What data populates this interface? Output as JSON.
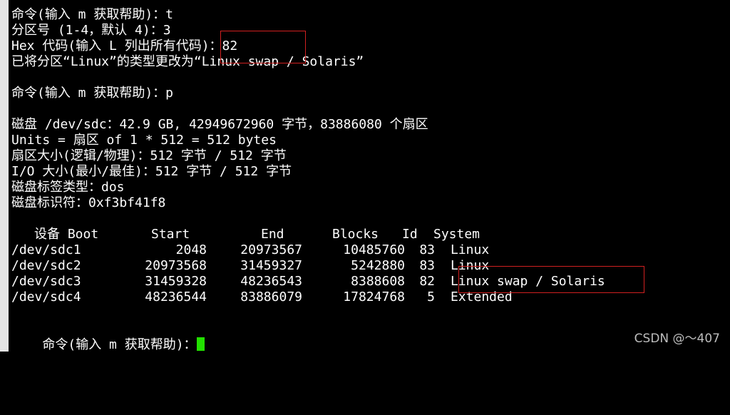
{
  "terminal": {
    "lines": [
      "命令(输入 m 获取帮助)：t",
      "分区号 (1-4，默认 4)：3",
      "Hex 代码(输入 L 列出所有代码)：82",
      "已将分区“Linux”的类型更改为“Linux swap / Solaris”",
      "",
      "命令(输入 m 获取帮助)：p",
      "",
      "磁盘 /dev/sdc：42.9 GB, 42949672960 字节，83886080 个扇区",
      "Units = 扇区 of 1 * 512 = 512 bytes",
      "扇区大小(逻辑/物理)：512 字节 / 512 字节",
      "I/O 大小(最小/最佳)：512 字节 / 512 字节",
      "磁盘标签类型：dos",
      "磁盘标识符：0xf3bf41f8"
    ],
    "table": {
      "headers": {
        "device": "设备 Boot",
        "start": "Start",
        "end": "End",
        "blocks": "Blocks",
        "id": "Id",
        "system": "System"
      },
      "rows": [
        {
          "device": "/dev/sdc1",
          "start": "2048",
          "end": "20973567",
          "blocks": "10485760",
          "id": "83",
          "system": "Linux"
        },
        {
          "device": "/dev/sdc2",
          "start": "20973568",
          "end": "31459327",
          "blocks": "5242880",
          "id": "83",
          "system": "Linux"
        },
        {
          "device": "/dev/sdc3",
          "start": "31459328",
          "end": "48236543",
          "blocks": "8388608",
          "id": "82",
          "system": "Linux swap / Solaris"
        },
        {
          "device": "/dev/sdc4",
          "start": "48236544",
          "end": "83886079",
          "blocks": "17824768",
          "id": "5",
          "system": "Extended"
        }
      ]
    },
    "final_prompt": "命令(输入 m 获取帮助)：",
    "cursor_color": "#22e000",
    "background_color": "#000000",
    "text_color": "#ffffff"
  },
  "annotation_color": "#d02020",
  "watermark": "CSDN @～407"
}
